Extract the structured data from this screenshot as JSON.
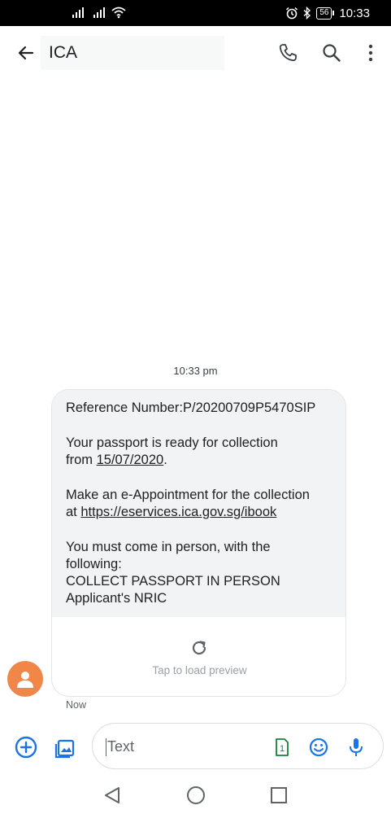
{
  "status_bar": {
    "time": "10:33",
    "battery": "56"
  },
  "app_bar": {
    "title": "ICA"
  },
  "conversation": {
    "timestamp": "10:33 pm",
    "message": {
      "reference": "Reference Number:P/20200709P5470SIP",
      "ready_line1": "Your passport is ready for collection",
      "ready_from": "from ",
      "ready_date": "15/07/2020",
      "ready_period": ".",
      "appt_line1": "Make an e-Appointment for the collection",
      "appt_at": "at ",
      "appt_link": "https://eservices.ica.gov.sg/ibook",
      "person_line1": "You must come in person, with the",
      "person_line2": "following:",
      "person_line3": "COLLECT PASSPORT IN PERSON",
      "person_line4": "Applicant's NRIC"
    },
    "preview_label": "Tap to load preview",
    "sent_status": "Now"
  },
  "composer": {
    "placeholder": "Text",
    "sim_number": "1"
  },
  "colors": {
    "accent": "#1a73e8",
    "avatar": "#f08749",
    "bubble": "#f1f3f4",
    "sim": "#188038"
  }
}
